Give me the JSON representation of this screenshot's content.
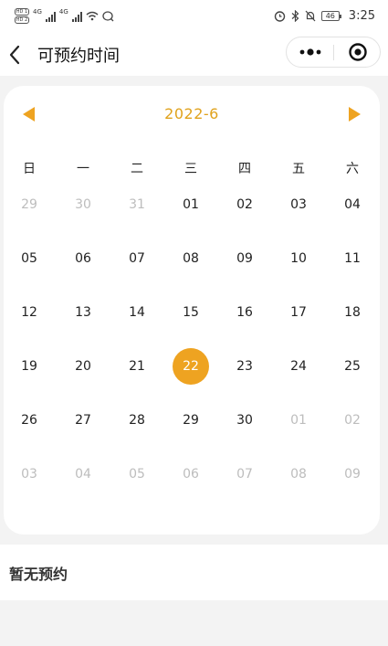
{
  "status_bar": {
    "sim1": "HD 1",
    "sim2": "HD 2",
    "net1": "4G",
    "net2": "4G",
    "battery": "46",
    "time": "3:25"
  },
  "nav": {
    "title": "可预约时间"
  },
  "calendar": {
    "month_label": "2022-6",
    "accent_color": "#eea321",
    "weekdays": [
      "日",
      "一",
      "二",
      "三",
      "四",
      "五",
      "六"
    ],
    "weeks": [
      [
        {
          "d": "29",
          "muted": true
        },
        {
          "d": "30",
          "muted": true
        },
        {
          "d": "31",
          "muted": true
        },
        {
          "d": "01"
        },
        {
          "d": "02"
        },
        {
          "d": "03"
        },
        {
          "d": "04"
        }
      ],
      [
        {
          "d": "05"
        },
        {
          "d": "06"
        },
        {
          "d": "07"
        },
        {
          "d": "08"
        },
        {
          "d": "09"
        },
        {
          "d": "10"
        },
        {
          "d": "11"
        }
      ],
      [
        {
          "d": "12"
        },
        {
          "d": "13"
        },
        {
          "d": "14"
        },
        {
          "d": "15"
        },
        {
          "d": "16"
        },
        {
          "d": "17"
        },
        {
          "d": "18"
        }
      ],
      [
        {
          "d": "19"
        },
        {
          "d": "20"
        },
        {
          "d": "21"
        },
        {
          "d": "22",
          "selected": true
        },
        {
          "d": "23"
        },
        {
          "d": "24"
        },
        {
          "d": "25"
        }
      ],
      [
        {
          "d": "26"
        },
        {
          "d": "27"
        },
        {
          "d": "28"
        },
        {
          "d": "29"
        },
        {
          "d": "30"
        },
        {
          "d": "01",
          "muted": true
        },
        {
          "d": "02",
          "muted": true
        }
      ],
      [
        {
          "d": "03",
          "muted": true
        },
        {
          "d": "04",
          "muted": true
        },
        {
          "d": "05",
          "muted": true
        },
        {
          "d": "06",
          "muted": true
        },
        {
          "d": "07",
          "muted": true
        },
        {
          "d": "08",
          "muted": true
        },
        {
          "d": "09",
          "muted": true
        }
      ]
    ]
  },
  "appointments": {
    "empty_text": "暂无预约"
  }
}
